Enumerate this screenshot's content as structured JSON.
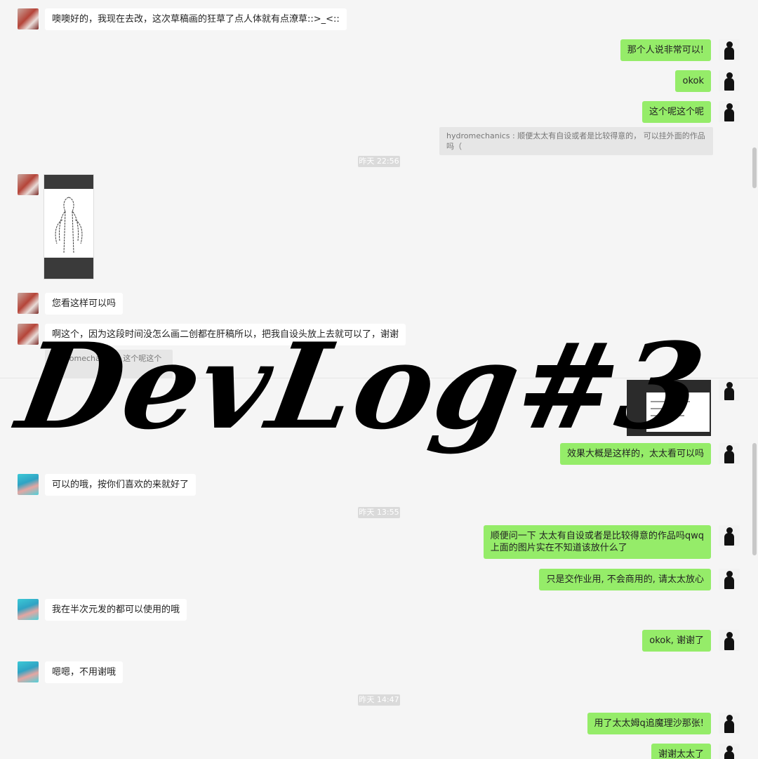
{
  "top": {
    "messages": [
      {
        "text": "噢噢好的，我现在去改，这次草稿画的狂草了点人体就有点潦草::>_<::"
      },
      {
        "text": "那个人说非常可以!"
      },
      {
        "text": "okok"
      },
      {
        "text": "这个呢这个呢"
      },
      {
        "quote": "hydromechanics : 顺便太太有自设或者是比较得意的， 可以挂外面的作品吗（"
      },
      {
        "time": "昨天 22:56"
      },
      {
        "text": "您看这样可以吗"
      },
      {
        "text": "啊这个，因为这段时间没怎么画二创都在肝稿所以，把我自设头放上去就可以了，谢谢"
      },
      {
        "quote": "hydromechanics : 这个呢这个呢"
      }
    ]
  },
  "bottom": {
    "messages": [
      {
        "text": "效果大概是这样的，太太看可以吗"
      },
      {
        "text": "可以的哦，按你们喜欢的来就好了"
      },
      {
        "time": "昨天 13:55"
      },
      {
        "text": "顺便问一下 太太有自设或者是比较得意的作品吗qwq\n上面的图片实在不知道该放什么了"
      },
      {
        "text": "只是交作业用, 不会商用的, 请太太放心"
      },
      {
        "text": "我在半次元发的都可以使用的哦"
      },
      {
        "text": "okok, 谢谢了"
      },
      {
        "text": "嗯嗯，不用谢哦"
      },
      {
        "time": "昨天 14:47"
      },
      {
        "text": "用了太太姆q追魔理沙那张!"
      },
      {
        "text": "谢谢太太了"
      }
    ]
  },
  "overlay": {
    "title": "DevLog#3"
  },
  "colors": {
    "self_bubble": "#95ec69",
    "other_bubble": "#ffffff",
    "background": "#f5f5f5"
  }
}
